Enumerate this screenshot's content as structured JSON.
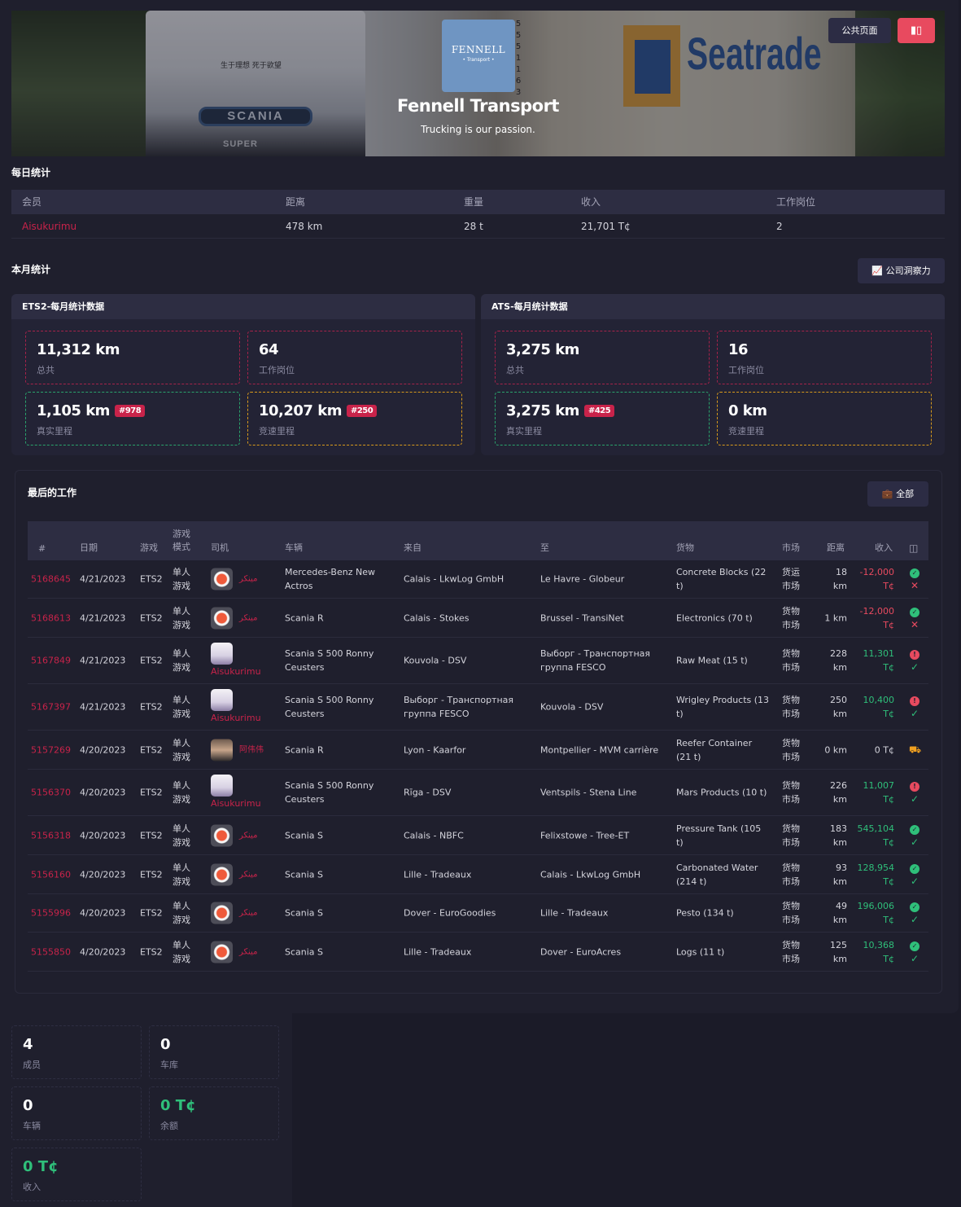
{
  "header": {
    "company_name": "Fennell Transport",
    "slogan": "Trucking is our passion.",
    "logo_text": "FENNELL",
    "logo_sub": "• Transport •",
    "btn_public": "公共页面",
    "banner_brand": "Seatrade",
    "banner_cab_brand": "SCANIA",
    "banner_cab_sub": "SUPER",
    "banner_cab_cn": "生于理想 死于欲望",
    "banner_digits": "5 5 5 1 1 6 3"
  },
  "daily": {
    "title": "每日统计",
    "columns": [
      "会员",
      "距离",
      "重量",
      "收入",
      "工作岗位"
    ],
    "rows": [
      {
        "member": "Aisukurimu",
        "distance": "478 km",
        "weight": "28 t",
        "income": "21,701 T¢",
        "jobs": "2"
      }
    ]
  },
  "monthly": {
    "title": "本月统计",
    "insight_button": "公司洞察力",
    "ets2": {
      "title": "ETS2-每月统计数据",
      "total": {
        "value": "11,312 km",
        "label": "总共"
      },
      "jobs": {
        "value": "64",
        "label": "工作岗位"
      },
      "real": {
        "value": "1,105 km",
        "badge": "#978",
        "label": "真实里程"
      },
      "race": {
        "value": "10,207 km",
        "badge": "#250",
        "label": "竞速里程"
      }
    },
    "ats": {
      "title": "ATS-每月统计数据",
      "total": {
        "value": "3,275 km",
        "label": "总共"
      },
      "jobs": {
        "value": "16",
        "label": "工作岗位"
      },
      "real": {
        "value": "3,275 km",
        "badge": "#425",
        "label": "真实里程"
      },
      "race": {
        "value": "0 km",
        "label": "竞速里程"
      }
    }
  },
  "jobs": {
    "title": "最后的工作",
    "all_button": "全部",
    "columns": {
      "id": "#",
      "date": "日期",
      "game": "游戏",
      "mode": "游戏\n模式",
      "driver": "司机",
      "truck": "车辆",
      "from": "来自",
      "to": "至",
      "cargo": "货物",
      "market": "市场",
      "distance": "距离",
      "income": "收入"
    },
    "rows": [
      {
        "id": "5168645",
        "date": "4/21/2023",
        "game": "ETS2",
        "mode": "单人\n游戏",
        "avatar": "a",
        "driver": "مينكر",
        "truck": "Mercedes-Benz New\nActros",
        "from": "Calais - LkwLog GmbH",
        "to": "Le Havre - Globeur",
        "cargo": "Concrete Blocks (22\nt)",
        "market": "货运\n市场",
        "distance": "18\nkm",
        "income": "-12,000\nT¢",
        "income_class": "neg",
        "status": "ok",
        "mark": "x"
      },
      {
        "id": "5168613",
        "date": "4/21/2023",
        "game": "ETS2",
        "mode": "单人\n游戏",
        "avatar": "a",
        "driver": "مينكر",
        "truck": "Scania R",
        "from": "Calais - Stokes",
        "to": "Brussel - TransiNet",
        "cargo": "Electronics (70 t)",
        "market": "货物\n市场",
        "distance": "1 km",
        "income": "-12,000\nT¢",
        "income_class": "neg",
        "status": "ok",
        "mark": "x"
      },
      {
        "id": "5167849",
        "date": "4/21/2023",
        "game": "ETS2",
        "mode": "单人\n游戏",
        "avatar": "b",
        "driver": "Aisukurimu",
        "truck": "Scania S 500 Ronny\nCeusters",
        "from": "Kouvola - DSV",
        "to": "Выборг - Транспортная\nгруппа FESCO",
        "cargo": "Raw Meat (15 t)",
        "market": "货物\n市场",
        "distance": "228\nkm",
        "income": "11,301 T¢",
        "income_class": "pos",
        "status": "bad",
        "mark": "v"
      },
      {
        "id": "5167397",
        "date": "4/21/2023",
        "game": "ETS2",
        "mode": "单人\n游戏",
        "avatar": "b",
        "driver": "Aisukurimu",
        "truck": "Scania S 500 Ronny\nCeusters",
        "from": "Выборг - Транспортная\nгруппа FESCO",
        "to": "Kouvola - DSV",
        "cargo": "Wrigley Products (13\nt)",
        "market": "货物\n市场",
        "distance": "250\nkm",
        "income": "10,400\nT¢",
        "income_class": "pos",
        "status": "bad",
        "mark": "v"
      },
      {
        "id": "5157269",
        "date": "4/20/2023",
        "game": "ETS2",
        "mode": "单人\n游戏",
        "avatar": "c",
        "driver": "阿伟伟",
        "truck": "Scania R",
        "from": "Lyon - Kaarfor",
        "to": "Montpellier - MVM carrière",
        "cargo": "Reefer Container\n(21 t)",
        "market": "货物\n市场",
        "distance": "0 km",
        "income": "0 T¢",
        "income_class": "plain",
        "status": "truck",
        "mark": ""
      },
      {
        "id": "5156370",
        "date": "4/20/2023",
        "game": "ETS2",
        "mode": "单人\n游戏",
        "avatar": "b",
        "driver": "Aisukurimu",
        "truck": "Scania S 500 Ronny\nCeusters",
        "from": "Rīga - DSV",
        "to": "Ventspils - Stena Line",
        "cargo": "Mars Products (10 t)",
        "market": "货物\n市场",
        "distance": "226\nkm",
        "income": "11,007\nT¢",
        "income_class": "pos",
        "status": "bad",
        "mark": "v"
      },
      {
        "id": "5156318",
        "date": "4/20/2023",
        "game": "ETS2",
        "mode": "单人\n游戏",
        "avatar": "a",
        "driver": "مينكر",
        "truck": "Scania S",
        "from": "Calais - NBFC",
        "to": "Felixstowe - Tree-ET",
        "cargo": "Pressure Tank (105\nt)",
        "market": "货物\n市场",
        "distance": "183\nkm",
        "income": "545,104\nT¢",
        "income_class": "pos",
        "status": "ok",
        "mark": "v"
      },
      {
        "id": "5156160",
        "date": "4/20/2023",
        "game": "ETS2",
        "mode": "单人\n游戏",
        "avatar": "a",
        "driver": "مينكر",
        "truck": "Scania S",
        "from": "Lille - Tradeaux",
        "to": "Calais - LkwLog GmbH",
        "cargo": "Carbonated Water\n(214 t)",
        "market": "货物\n市场",
        "distance": "93\nkm",
        "income": "128,954\nT¢",
        "income_class": "pos",
        "status": "ok",
        "mark": "v"
      },
      {
        "id": "5155996",
        "date": "4/20/2023",
        "game": "ETS2",
        "mode": "单人\n游戏",
        "avatar": "a",
        "driver": "مينكر",
        "truck": "Scania S",
        "from": "Dover - EuroGoodies",
        "to": "Lille - Tradeaux",
        "cargo": "Pesto (134 t)",
        "market": "货物\n市场",
        "distance": "49\nkm",
        "income": "196,006\nT¢",
        "income_class": "pos",
        "status": "ok",
        "mark": "v"
      },
      {
        "id": "5155850",
        "date": "4/20/2023",
        "game": "ETS2",
        "mode": "单人\n游戏",
        "avatar": "a",
        "driver": "مينكر",
        "truck": "Scania S",
        "from": "Lille - Tradeaux",
        "to": "Dover - EuroAcres",
        "cargo": "Logs (11 t)",
        "market": "货物\n市场",
        "distance": "125\nkm",
        "income": "10,368\nT¢",
        "income_class": "pos",
        "status": "ok",
        "mark": "v"
      }
    ]
  },
  "company_stats": {
    "members": {
      "value": "4",
      "label": "成员"
    },
    "garages": {
      "value": "0",
      "label": "车库"
    },
    "trucks": {
      "value": "0",
      "label": "车辆"
    },
    "balance": {
      "value": "0 T¢",
      "label": "余额"
    },
    "income": {
      "value": "0 T¢",
      "label": "收入"
    }
  }
}
